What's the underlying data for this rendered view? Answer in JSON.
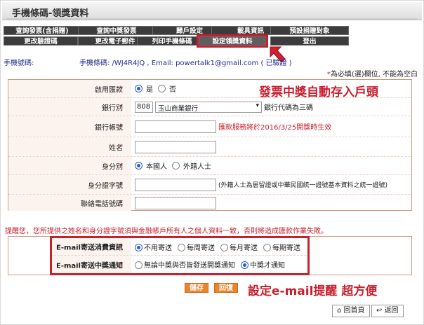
{
  "page_title": "手機條碼-領獎資料",
  "nav": {
    "row1": [
      "查詢發票(含捐贈)",
      "查詢中獎發票",
      "歸戶設定",
      "載具資訊",
      "預設捐贈對象"
    ],
    "row2": [
      "更改驗證碼",
      "更改電子郵件",
      "列印手機條碼",
      "設定領獎資料",
      "登出"
    ]
  },
  "info": {
    "label": "手機號碼:",
    "value": "手機條碼: /WJ4R4JQ , Email: powertalk1@gmail.com ( 已驗證 )"
  },
  "required_note": {
    "star": "*",
    "text": "為必填(選)欄位, 不能為空白"
  },
  "form": {
    "rows": [
      {
        "label": "啟用匯款",
        "required": true
      },
      {
        "label": "銀行別",
        "required": true
      },
      {
        "label": "銀行帳號",
        "required": true
      },
      {
        "label": "姓名",
        "required": true
      },
      {
        "label": "身分別",
        "required": true
      },
      {
        "label": "身分證字號",
        "required": true
      },
      {
        "label": "聯絡電話號碼",
        "required": true
      }
    ],
    "enable_options": {
      "yes": "是",
      "no": "否",
      "selected": "是"
    },
    "bank_code": "808",
    "bank_name": "玉山商業銀行",
    "bank_code_hint": "銀行代碼為三碼",
    "account_note": "匯款服務將於2016/3/25開獎時生效",
    "identity_options": {
      "citizen": "本國人",
      "foreigner": "外籍人士",
      "selected": "本國人"
    },
    "id_hint": "(外籍人士為居留證或中華民國統一證號基本資料之統一證號)"
  },
  "callouts": {
    "top": "發票中獎自動存入戶頭",
    "bottom": "設定e-mail提醒 超方便"
  },
  "warning": "提醒您，您所提供之姓名和身分證字號須與金融帳戶所有人之個人資料一致，否則將造成匯款作業失敗。",
  "email": {
    "consumption_label": "E-mail寄送消費資訊",
    "consumption_options": [
      "不用寄送",
      "每周寄送",
      "每月寄送",
      "每期寄送"
    ],
    "consumption_selected": "不用寄送",
    "winning_label": "E-mail寄送中獎通知",
    "winning_options": [
      "無論中獎與否皆發送開獎通知",
      "中獎才通知"
    ],
    "winning_selected": "中獎才通知"
  },
  "actions": {
    "save": "儲存",
    "reset": "回復",
    "home": "回首頁",
    "back": "返回"
  },
  "colors": {
    "accent": "#c8202f",
    "nav_bg": "#3c3c3c",
    "button_orange": "#e9862b",
    "link_blue": "#1e2d8c"
  }
}
